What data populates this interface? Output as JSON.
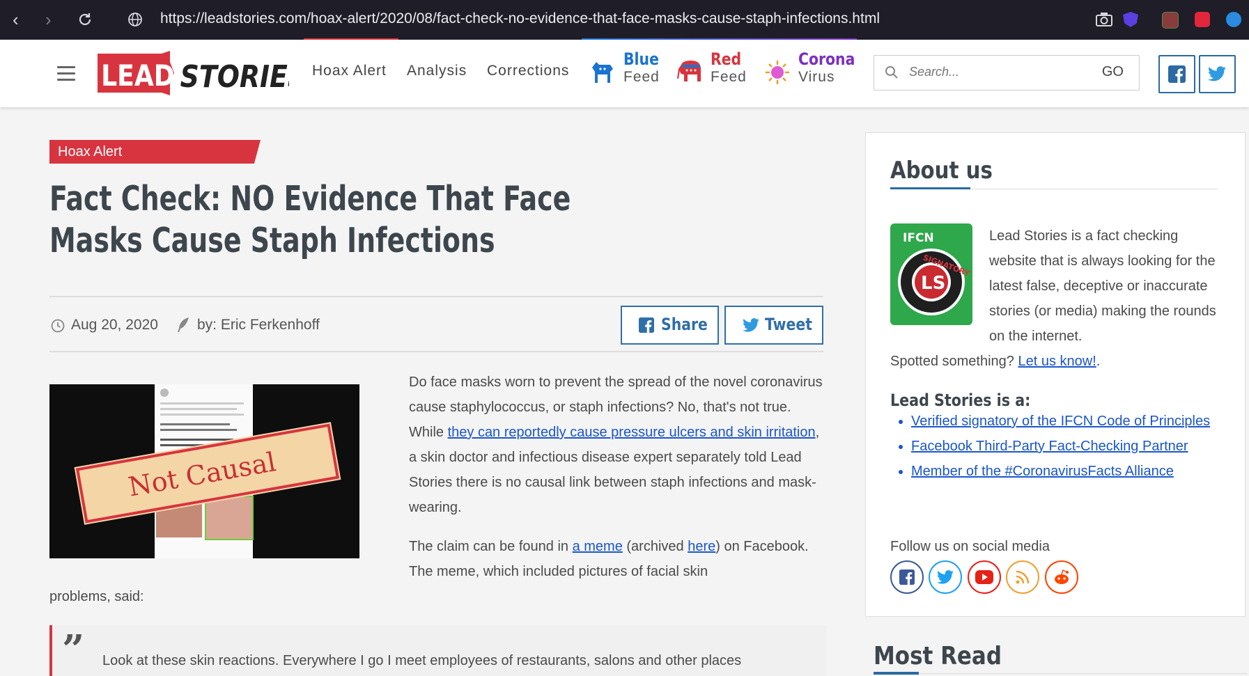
{
  "browser": {
    "url": "https://leadstories.com/hoax-alert/2020/08/fact-check-no-evidence-that-face-masks-cause-staph-infections.html"
  },
  "header": {
    "logo_left": "LEAD",
    "logo_right": "STORIES",
    "menu": [
      "Hoax Alert",
      "Analysis",
      "Corrections"
    ],
    "feeds": [
      {
        "title": "Blue",
        "sub": "Feed",
        "color": "#1a73d1"
      },
      {
        "title": "Red",
        "sub": "Feed",
        "color": "#d8343f"
      },
      {
        "title": "Corona",
        "sub": "Virus",
        "color": "#7b2fbf"
      }
    ],
    "search_placeholder": "Search...",
    "search_go": "GO"
  },
  "article": {
    "category": "Hoax Alert",
    "title": "Fact Check: NO Evidence That Face Masks Cause Staph Infections",
    "date": "Aug 20, 2020",
    "author": "by: Eric Ferkenhoff",
    "share_label": "Share",
    "tweet_label": "Tweet",
    "image_stamp": "Not Causal",
    "p1_a": "Do face masks worn to prevent the spread of the novel coronavirus cause staphylococcus, or staph infections? No, that's not true. While ",
    "p1_link": "they can reportedly cause pressure ulcers and skin irritation",
    "p1_b": ", a skin doctor and infectious disease expert separately told Lead Stories there is no causal link between staph infections and mask-wearing.",
    "p2_a": "The claim can be found in ",
    "p2_link1": "a meme",
    "p2_b": " (archived ",
    "p2_link2": "here",
    "p2_c": ") on Facebook. The meme, which included pictures of facial skin",
    "p2_d": "problems, said:",
    "quote_text": "Look at these skin reactions. Everywhere I go I meet employees of restaurants, salons and other places"
  },
  "sidebar": {
    "about_title": "About us",
    "badge_top": "IFCN",
    "badge_ring": "SIGNATORY",
    "badge_center": "LS",
    "about_text": "Lead Stories is a fact checking website that is always looking for the latest false, deceptive or inaccurate stories (or media) making the rounds on the internet.",
    "spotted": "Spotted something? ",
    "spotted_link": "Let us know!",
    "spotted_end": ".",
    "is_a_title": "Lead Stories is a:",
    "is_a_items": [
      "Verified signatory of the IFCN Code of Principles",
      "Facebook Third-Party Fact-Checking Partner",
      "Member of the #CoronavirusFacts Alliance"
    ],
    "follow": "Follow us on social media",
    "social": [
      {
        "name": "facebook-icon",
        "color": "#3b5998"
      },
      {
        "name": "twitter-icon",
        "color": "#1da1f2"
      },
      {
        "name": "youtube-icon",
        "color": "#e62117"
      },
      {
        "name": "rss-icon",
        "color": "#f0a030"
      },
      {
        "name": "reddit-icon",
        "color": "#ff4500"
      }
    ],
    "most_read": "Most Read"
  }
}
